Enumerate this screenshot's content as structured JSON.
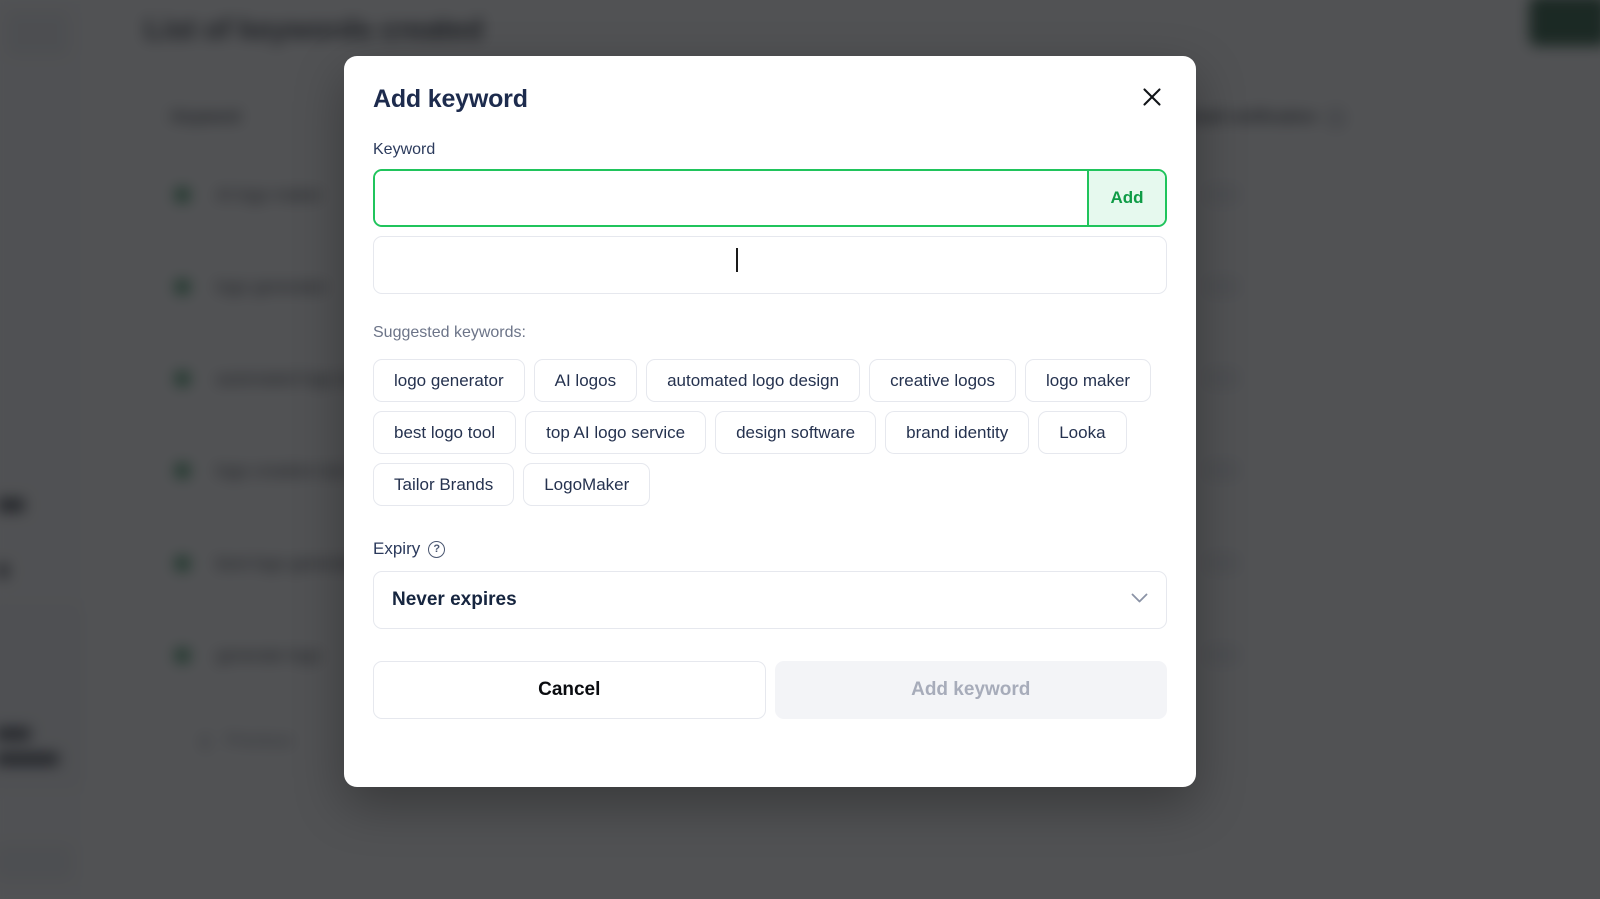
{
  "background": {
    "page_title": "List of keywords created",
    "page_title_icon": "info-icon",
    "table": {
      "columns": [
        "Keyword",
        "Email notification"
      ],
      "rows": [
        {
          "status": "active",
          "keyword": "AI logo maker"
        },
        {
          "status": "active",
          "keyword": "logo generator"
        },
        {
          "status": "active",
          "keyword": "automated logo design"
        },
        {
          "status": "active",
          "keyword": "logo creation tool"
        },
        {
          "status": "active",
          "keyword": "best logo generator"
        },
        {
          "status": "active",
          "keyword": "generate logo"
        }
      ]
    },
    "pagination": {
      "previous_label": "Previous",
      "previous_icon": "chevron-left-icon"
    },
    "status_dot_color": "#0b7a3c",
    "top_right_button_color": "#0d4426"
  },
  "modal": {
    "title": "Add keyword",
    "close_icon": "close-icon",
    "keyword": {
      "label": "Keyword",
      "value": "",
      "placeholder": "",
      "add_button_label": "Add",
      "focus_border_color": "#20c45c",
      "add_button_bg": "#e6f9ee",
      "add_button_text_color": "#0f9c46"
    },
    "selected_keywords": [],
    "suggested": {
      "label": "Suggested keywords:",
      "chips": [
        "logo generator",
        "AI logos",
        "automated logo design",
        "creative logos",
        "logo maker",
        "best logo tool",
        "top AI logo service",
        "design software",
        "brand identity",
        "Looka",
        "Tailor Brands",
        "LogoMaker"
      ]
    },
    "expiry": {
      "label": "Expiry",
      "help_icon": "help-circle-icon",
      "selected": "Never expires",
      "chevron_icon": "chevron-down-icon"
    },
    "footer": {
      "cancel_label": "Cancel",
      "submit_label": "Add keyword",
      "submit_disabled": true
    }
  }
}
